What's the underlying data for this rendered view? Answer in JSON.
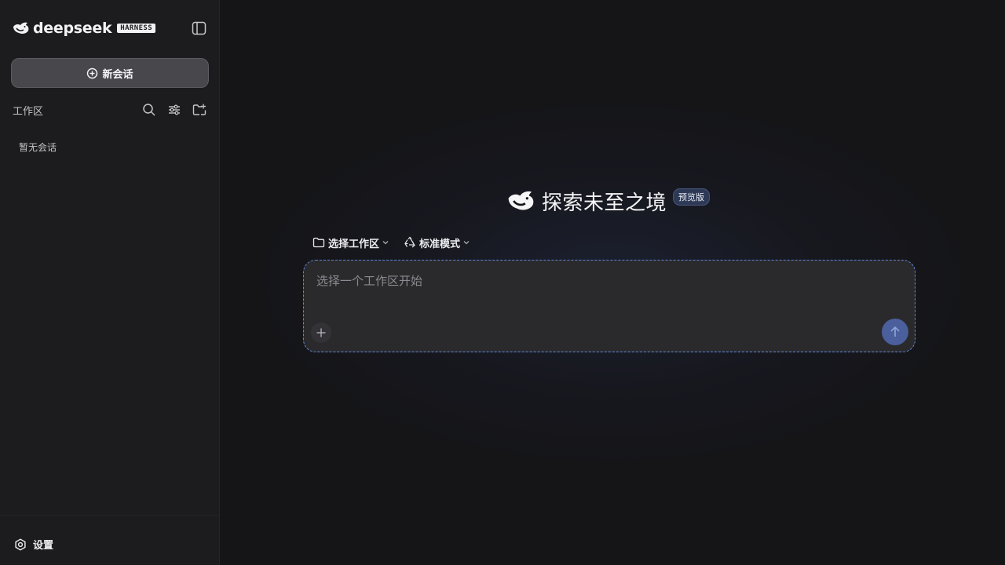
{
  "brand": {
    "name": "deepseek",
    "badge": "HARNESS"
  },
  "sidebar": {
    "new_chat_label": "新会话",
    "workspace_label": "工作区",
    "empty_text": "暂无会话",
    "settings_label": "设置",
    "icons": {
      "collapse": "sidebar-toggle-icon",
      "new_chat": "plus-circle-icon",
      "search": "search-icon",
      "filter": "sliders-icon",
      "new_folder": "folder-plus-icon",
      "settings": "gear-icon"
    }
  },
  "hero": {
    "title": "探索未至之境",
    "badge": "预览版",
    "logo_icon": "whale-icon"
  },
  "toolbar": {
    "workspace_select": "选择工作区",
    "mode_select": "标准模式",
    "icons": {
      "workspace": "folder-icon",
      "mode": "recycle-icon",
      "chevron": "chevron-down-icon"
    }
  },
  "composer": {
    "placeholder": "选择一个工作区开始",
    "value": "",
    "icons": {
      "attach": "plus-icon",
      "send": "arrow-up-icon"
    }
  },
  "colors": {
    "sidebar_bg": "#1c1c1f",
    "main_bg": "#151518",
    "accent_border": "#5f86d9",
    "send_button": "#4a5f9c",
    "badge_bg": "#2e3a55"
  }
}
